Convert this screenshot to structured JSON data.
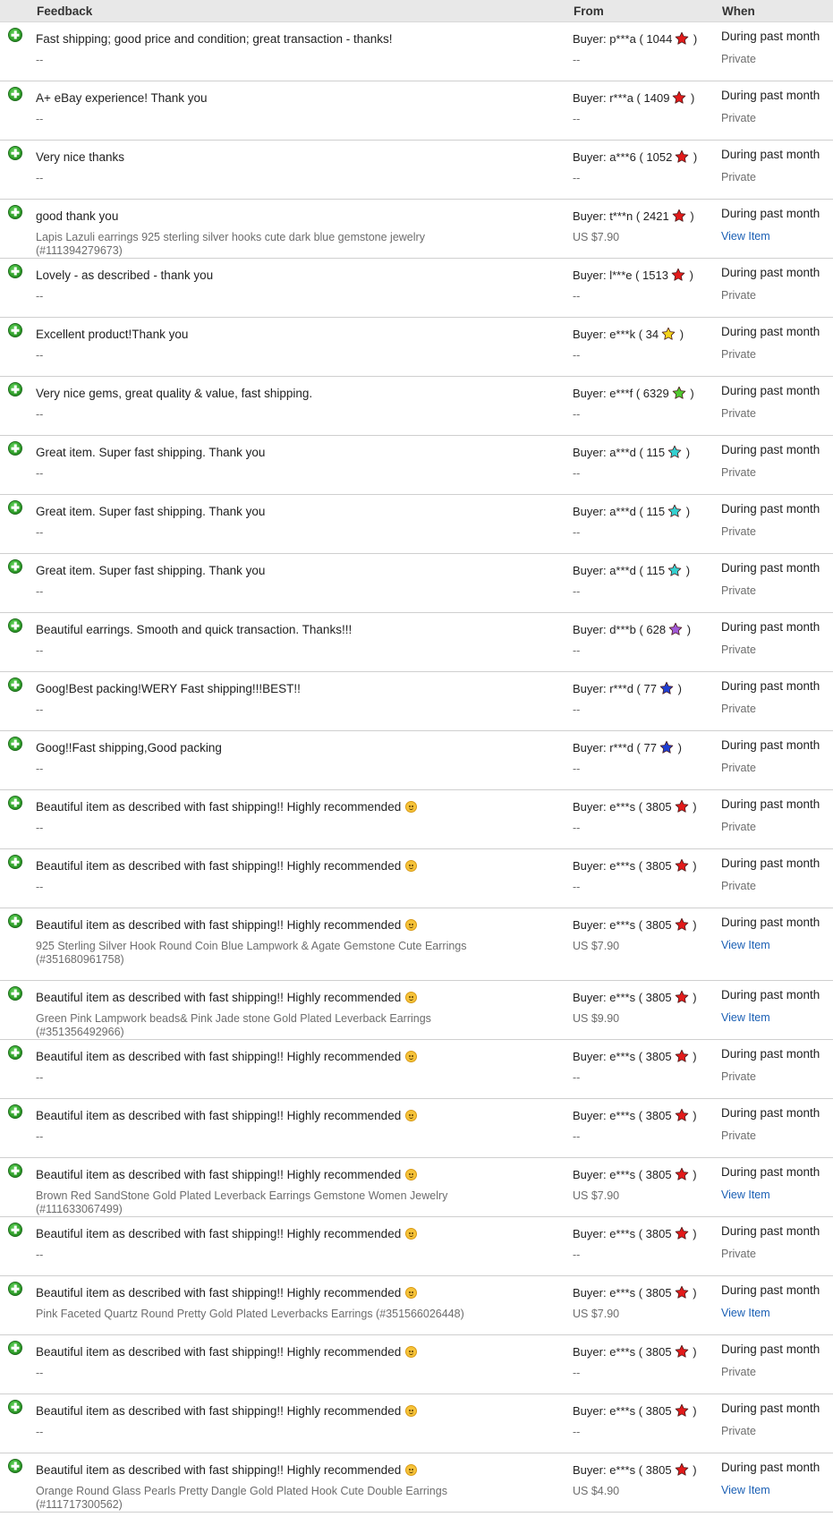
{
  "header": {
    "feedback": "Feedback",
    "from": "From",
    "when": "When"
  },
  "colors": {
    "red": "#e21a1a",
    "yellow": "#f3d31c",
    "green": "#4fc92f",
    "turquoise": "#34d0d0",
    "purple": "#a15ad8",
    "blue": "#1f3fd3",
    "link": "#1a5fb4",
    "header_bg": "#e8e8e8"
  },
  "rows": [
    {
      "fb": "Fast shipping; good price and condition; great transaction - thanks!",
      "emoji": false,
      "item": "--",
      "buyer": "p***a",
      "score": "1044",
      "star": "red",
      "price": "--",
      "when": "During past month",
      "sub": "Private",
      "link": false
    },
    {
      "fb": "A+ eBay experience! Thank you",
      "emoji": false,
      "item": "--",
      "buyer": "r***a",
      "score": "1409",
      "star": "red",
      "price": "--",
      "when": "During past month",
      "sub": "Private",
      "link": false
    },
    {
      "fb": "Very nice thanks",
      "emoji": false,
      "item": "--",
      "buyer": "a***6",
      "score": "1052",
      "star": "red",
      "price": "--",
      "when": "During past month",
      "sub": "Private",
      "link": false
    },
    {
      "fb": "good thank you",
      "emoji": false,
      "item": "Lapis Lazuli earrings 925 sterling silver hooks cute dark blue gemstone jewelry (#111394279673)",
      "buyer": "t***n",
      "score": "2421",
      "star": "red",
      "price": "US $7.90",
      "when": "During past month",
      "sub": "View Item",
      "link": true
    },
    {
      "fb": "Lovely - as described - thank you",
      "emoji": false,
      "item": "--",
      "buyer": "l***e",
      "score": "1513",
      "star": "red",
      "price": "--",
      "when": "During past month",
      "sub": "Private",
      "link": false
    },
    {
      "fb": "Excellent product!Thank you",
      "emoji": false,
      "item": "--",
      "buyer": "e***k",
      "score": "34",
      "star": "yellow",
      "price": "--",
      "when": "During past month",
      "sub": "Private",
      "link": false
    },
    {
      "fb": "Very nice gems, great quality & value, fast shipping.",
      "emoji": false,
      "item": "--",
      "buyer": "e***f",
      "score": "6329",
      "star": "green",
      "price": "--",
      "when": "During past month",
      "sub": "Private",
      "link": false
    },
    {
      "fb": "Great item. Super fast shipping. Thank you",
      "emoji": false,
      "item": "--",
      "buyer": "a***d",
      "score": "115",
      "star": "turquoise",
      "price": "--",
      "when": "During past month",
      "sub": "Private",
      "link": false
    },
    {
      "fb": "Great item. Super fast shipping. Thank you",
      "emoji": false,
      "item": "--",
      "buyer": "a***d",
      "score": "115",
      "star": "turquoise",
      "price": "--",
      "when": "During past month",
      "sub": "Private",
      "link": false
    },
    {
      "fb": "Great item. Super fast shipping. Thank you",
      "emoji": false,
      "item": "--",
      "buyer": "a***d",
      "score": "115",
      "star": "turquoise",
      "price": "--",
      "when": "During past month",
      "sub": "Private",
      "link": false
    },
    {
      "fb": "Beautiful earrings. Smooth and quick transaction. Thanks!!!",
      "emoji": false,
      "item": "--",
      "buyer": "d***b",
      "score": "628",
      "star": "purple",
      "price": "--",
      "when": "During past month",
      "sub": "Private",
      "link": false
    },
    {
      "fb": "Goog!Best packing!WERY Fast shipping!!!BEST!!",
      "emoji": false,
      "item": "--",
      "buyer": "r***d",
      "score": "77",
      "star": "blue",
      "price": "--",
      "when": "During past month",
      "sub": "Private",
      "link": false
    },
    {
      "fb": "Goog!!Fast shipping,Good packing",
      "emoji": false,
      "item": "--",
      "buyer": "r***d",
      "score": "77",
      "star": "blue",
      "price": "--",
      "when": "During past month",
      "sub": "Private",
      "link": false
    },
    {
      "fb": "Beautiful item as described with fast shipping!! Highly recommended",
      "emoji": true,
      "item": "--",
      "buyer": "e***s",
      "score": "3805",
      "star": "red",
      "price": "--",
      "when": "During past month",
      "sub": "Private",
      "link": false
    },
    {
      "fb": "Beautiful item as described with fast shipping!! Highly recommended",
      "emoji": true,
      "item": "--",
      "buyer": "e***s",
      "score": "3805",
      "star": "red",
      "price": "--",
      "when": "During past month",
      "sub": "Private",
      "link": false
    },
    {
      "fb": "Beautiful item as described with fast shipping!! Highly recommended",
      "emoji": true,
      "item": "925 Sterling Silver Hook Round Coin Blue Lampwork & Agate Gemstone Cute Earrings (#351680961758)",
      "buyer": "e***s",
      "score": "3805",
      "star": "red",
      "price": "US $7.90",
      "when": "During past month",
      "sub": "View Item",
      "link": true,
      "tall": true
    },
    {
      "fb": "Beautiful item as described with fast shipping!! Highly recommended",
      "emoji": true,
      "item": "Green Pink Lampwork beads& Pink Jade stone Gold Plated Leverback Earrings (#351356492966)",
      "buyer": "e***s",
      "score": "3805",
      "star": "red",
      "price": "US $9.90",
      "when": "During past month",
      "sub": "View Item",
      "link": true
    },
    {
      "fb": "Beautiful item as described with fast shipping!! Highly recommended",
      "emoji": true,
      "item": "--",
      "buyer": "e***s",
      "score": "3805",
      "star": "red",
      "price": "--",
      "when": "During past month",
      "sub": "Private",
      "link": false
    },
    {
      "fb": "Beautiful item as described with fast shipping!! Highly recommended",
      "emoji": true,
      "item": "--",
      "buyer": "e***s",
      "score": "3805",
      "star": "red",
      "price": "--",
      "when": "During past month",
      "sub": "Private",
      "link": false
    },
    {
      "fb": "Beautiful item as described with fast shipping!! Highly recommended",
      "emoji": true,
      "item": "Brown Red SandStone Gold Plated Leverback Earrings Gemstone Women Jewelry (#111633067499)",
      "buyer": "e***s",
      "score": "3805",
      "star": "red",
      "price": "US $7.90",
      "when": "During past month",
      "sub": "View Item",
      "link": true
    },
    {
      "fb": "Beautiful item as described with fast shipping!! Highly recommended",
      "emoji": true,
      "item": "--",
      "buyer": "e***s",
      "score": "3805",
      "star": "red",
      "price": "--",
      "when": "During past month",
      "sub": "Private",
      "link": false
    },
    {
      "fb": "Beautiful item as described with fast shipping!! Highly recommended",
      "emoji": true,
      "item": "Pink Faceted Quartz Round Pretty Gold Plated Leverbacks Earrings (#351566026448)",
      "buyer": "e***s",
      "score": "3805",
      "star": "red",
      "price": "US $7.90",
      "when": "During past month",
      "sub": "View Item",
      "link": true
    },
    {
      "fb": "Beautiful item as described with fast shipping!! Highly recommended",
      "emoji": true,
      "item": "--",
      "buyer": "e***s",
      "score": "3805",
      "star": "red",
      "price": "--",
      "when": "During past month",
      "sub": "Private",
      "link": false
    },
    {
      "fb": "Beautiful item as described with fast shipping!! Highly recommended",
      "emoji": true,
      "item": "--",
      "buyer": "e***s",
      "score": "3805",
      "star": "red",
      "price": "--",
      "when": "During past month",
      "sub": "Private",
      "link": false
    },
    {
      "fb": "Beautiful item as described with fast shipping!! Highly recommended",
      "emoji": true,
      "item": "Orange Round Glass Pearls Pretty Dangle Gold Plated Hook Cute Double Earrings (#111717300562)",
      "buyer": "e***s",
      "score": "3805",
      "star": "red",
      "price": "US $4.90",
      "when": "During past month",
      "sub": "View Item",
      "link": true
    }
  ]
}
